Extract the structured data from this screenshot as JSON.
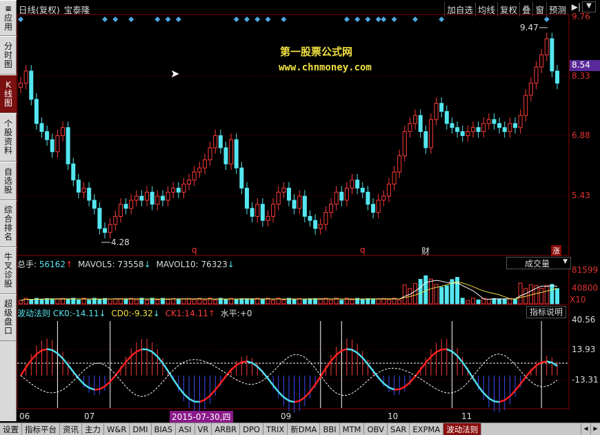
{
  "header": {
    "title": "日线(复权)",
    "stock": "宝泰隆",
    "toolbar": [
      "加自选",
      "均线",
      "复权",
      "叠",
      "窗",
      "预测"
    ],
    "extra_icon": "panel-toggle-icon",
    "menu_icon": "chevron-down-icon"
  },
  "sidebar": [
    {
      "label": "应用",
      "icon": "grid-icon"
    },
    {
      "label": "分时图"
    },
    {
      "label": "K线图",
      "prefix": "K"
    },
    {
      "label": "个股资料"
    },
    {
      "label": "自选股"
    },
    {
      "label": "综合排名"
    },
    {
      "label": "牛叉诊股"
    },
    {
      "label": "超级盘口"
    }
  ],
  "watermark": {
    "line1": "第一股票公式网",
    "line2": "www.chnmoney.com"
  },
  "price_axis": [
    "9.76",
    "8.33",
    "6.88",
    "5.43"
  ],
  "current_price": "8.54",
  "annotations": {
    "high": "9.47",
    "low": "4.28",
    "markers": [
      "q",
      "q",
      "财",
      "涨"
    ]
  },
  "volume": {
    "label": "总手:",
    "value": "56162",
    "mavol5_label": "MAVOL5:",
    "mavol5": "73558",
    "mavol10_label": "MAVOL10:",
    "mavol10": "76323",
    "dropdown": "成交量",
    "axis": [
      "81599",
      "40800",
      "X10"
    ]
  },
  "indicator": {
    "name": "波动法则",
    "ck0_label": "CK0:",
    "ck0": "-14.11",
    "cd0_label": "CD0:",
    "cd0": "-9.32",
    "ck1_label": "CK1:",
    "ck1": "14.11",
    "level_label": "水平:",
    "level": "+0",
    "button": "指标说明",
    "axis": [
      "40.56",
      "13.93",
      "-13.31"
    ]
  },
  "dates": [
    "06",
    "07",
    "09",
    "10",
    "11"
  ],
  "date_cursor": "2015-07-30,四",
  "tabs": [
    "设置",
    "指标平台",
    "资讯",
    "主力",
    "W&R",
    "DMI",
    "BIAS",
    "ASI",
    "VR",
    "ARBR",
    "DPO",
    "TRIX",
    "新DMA",
    "BBI",
    "MTM",
    "OBV",
    "SAR",
    "EXPMA",
    "波动法则"
  ],
  "active_tab": "波动法则",
  "colors": {
    "up": "#ff3b3b",
    "down": "#54e6f0",
    "bg": "#000000",
    "grid": "#8b0000"
  },
  "chart_data": [
    {
      "type": "candlestick",
      "title": "",
      "price_levels": [
        9.76,
        8.33,
        6.88,
        5.43
      ],
      "ylim": [
        4.0,
        9.9
      ],
      "x_ticks": [
        "06",
        "07",
        "09",
        "10",
        "11"
      ],
      "high_label": 9.47,
      "low_label": 4.28,
      "closes": [
        8.2,
        8.5,
        7.8,
        7.2,
        7.0,
        6.8,
        6.5,
        6.9,
        7.1,
        6.2,
        5.8,
        5.5,
        5.6,
        5.3,
        5.1,
        4.6,
        4.5,
        4.7,
        4.9,
        5.2,
        5.1,
        5.3,
        5.4,
        5.3,
        5.5,
        5.2,
        5.4,
        5.3,
        5.5,
        5.6,
        5.5,
        5.7,
        5.8,
        6.0,
        6.1,
        6.3,
        6.6,
        6.9,
        6.6,
        6.2,
        6.8,
        6.1,
        5.6,
        5.1,
        4.9,
        5.2,
        4.8,
        4.9,
        5.2,
        5.5,
        5.6,
        5.3,
        5.1,
        5.4,
        4.9,
        4.8,
        4.6,
        4.7,
        5.0,
        5.2,
        5.5,
        5.3,
        5.6,
        5.8,
        5.6,
        5.5,
        5.2,
        5.0,
        5.3,
        5.4,
        5.7,
        6.0,
        6.4,
        7.0,
        7.2,
        7.4,
        7.0,
        6.6,
        7.3,
        7.7,
        7.5,
        7.2,
        7.1,
        7.0,
        6.9,
        7.0,
        7.1,
        7.0,
        7.2,
        7.3,
        7.2,
        7.1,
        7.0,
        7.2,
        7.1,
        7.4,
        7.9,
        8.2,
        8.6,
        8.9,
        9.3,
        8.5,
        8.2
      ]
    },
    {
      "type": "bar",
      "title": "成交量",
      "ylim": [
        0,
        95000
      ],
      "levels": [
        81599,
        40800
      ],
      "mavol5": 73558,
      "mavol10": 76323,
      "last_volume": 56162
    },
    {
      "type": "line",
      "title": "波动法则",
      "ylim": [
        -30,
        55
      ],
      "levels": [
        40.56,
        13.93,
        -13.31
      ],
      "series": [
        {
          "name": "CK0",
          "last": -14.11
        },
        {
          "name": "CD0",
          "last": -9.32
        },
        {
          "name": "CK1",
          "last": 14.11
        }
      ]
    }
  ]
}
